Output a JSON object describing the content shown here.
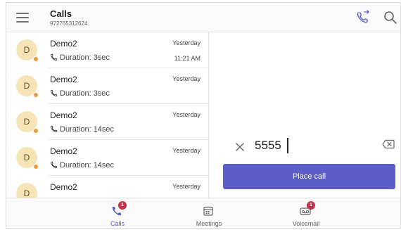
{
  "header": {
    "title": "Calls",
    "subtitle": "972765312624"
  },
  "calls": [
    {
      "initial": "D",
      "name": "Demo2",
      "duration": "Duration: 3sec",
      "date": "Yesterday",
      "time": "11:21 AM"
    },
    {
      "initial": "D",
      "name": "Demo2",
      "duration": "Duration: 3sec",
      "date": "Yesterday",
      "time": ""
    },
    {
      "initial": "D",
      "name": "Demo2",
      "duration": "Duration: 14sec",
      "date": "Yesterday",
      "time": ""
    },
    {
      "initial": "D",
      "name": "Demo2",
      "duration": "Duration: 14sec",
      "date": "Yesterday",
      "time": ""
    },
    {
      "initial": "D",
      "name": "Demo2",
      "duration": "",
      "date": "Yesterday",
      "time": ""
    }
  ],
  "dialpad": {
    "number": "5555",
    "place_call_label": "Place call"
  },
  "nav": {
    "calls_label": "Calls",
    "calls_badge": "1",
    "meetings_label": "Meetings",
    "voicemail_label": "Voicemail",
    "voicemail_badge": "1"
  },
  "colors": {
    "accent": "#5b5fc7",
    "avatar_bg": "#f6e3b6",
    "presence": "#e99a3a",
    "badge": "#c4314b"
  },
  "icons": {
    "menu": "hamburger-icon",
    "call_settings": "phone-forward-icon",
    "search": "search-icon",
    "duration": "phone-icon",
    "clear": "close-icon",
    "backspace": "backspace-icon",
    "calls_tab": "phone-icon",
    "meetings_tab": "calendar-icon",
    "voicemail_tab": "voicemail-icon"
  }
}
